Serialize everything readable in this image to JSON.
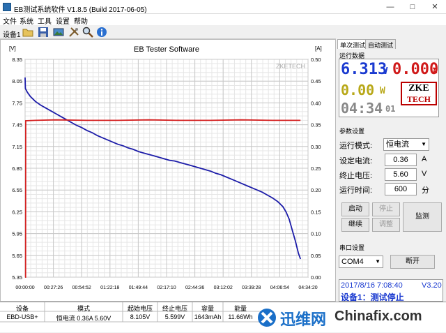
{
  "window": {
    "title": "EB测试系统软件 V1.8.5 (Build 2017-06-05)"
  },
  "menu": [
    "文件",
    "系统",
    "工具",
    "设置",
    "帮助"
  ],
  "toolbar": {
    "device": "设备1"
  },
  "chart_data": {
    "type": "line",
    "title": "EB Tester Software",
    "watermark": "ZKETECH",
    "y_left_unit": "[V]",
    "y_right_unit": "[A]",
    "y_left_ticks": [
      "8.35",
      "8.05",
      "7.75",
      "7.45",
      "7.15",
      "6.85",
      "6.55",
      "6.25",
      "5.95",
      "5.65",
      "5.35"
    ],
    "y_right_ticks": [
      "0.50",
      "0.45",
      "0.40",
      "0.35",
      "0.30",
      "0.25",
      "0.20",
      "0.15",
      "0.10",
      "0.05",
      "0.00"
    ],
    "x_ticks": [
      "00:00:00",
      "00:27:26",
      "00:54:52",
      "01:22:18",
      "01:49:44",
      "02:17:10",
      "02:44:36",
      "03:12:02",
      "03:39:28",
      "04:06:54",
      "04:34:20"
    ],
    "ylim_left": [
      5.35,
      8.35
    ],
    "ylim_right": [
      0,
      0.5
    ],
    "series": [
      {
        "color": "#1c1ca8",
        "axis": "left",
        "points": [
          [
            0,
            8.1
          ],
          [
            0.3,
            7.95
          ],
          [
            2,
            7.9
          ],
          [
            5,
            7.84
          ],
          [
            10,
            7.77
          ],
          [
            15,
            7.72
          ],
          [
            20,
            7.68
          ],
          [
            25,
            7.64
          ],
          [
            30,
            7.6
          ],
          [
            35,
            7.56
          ],
          [
            40,
            7.52
          ],
          [
            45,
            7.48
          ],
          [
            50,
            7.44
          ],
          [
            55,
            7.41
          ],
          [
            60,
            7.37
          ],
          [
            65,
            7.34
          ],
          [
            70,
            7.3
          ],
          [
            75,
            7.27
          ],
          [
            80,
            7.24
          ],
          [
            85,
            7.21
          ],
          [
            90,
            7.18
          ],
          [
            95,
            7.16
          ],
          [
            100,
            7.13
          ],
          [
            105,
            7.11
          ],
          [
            110,
            7.08
          ],
          [
            115,
            7.06
          ],
          [
            120,
            7.04
          ],
          [
            125,
            7.02
          ],
          [
            130,
            7.0
          ],
          [
            135,
            6.98
          ],
          [
            140,
            6.96
          ],
          [
            145,
            6.95
          ],
          [
            150,
            6.93
          ],
          [
            155,
            6.91
          ],
          [
            160,
            6.89
          ],
          [
            165,
            6.87
          ],
          [
            170,
            6.85
          ],
          [
            175,
            6.83
          ],
          [
            180,
            6.81
          ],
          [
            185,
            6.78
          ],
          [
            190,
            6.76
          ],
          [
            195,
            6.73
          ],
          [
            200,
            6.7
          ],
          [
            205,
            6.67
          ],
          [
            210,
            6.64
          ],
          [
            215,
            6.61
          ],
          [
            220,
            6.58
          ],
          [
            225,
            6.55
          ],
          [
            230,
            6.52
          ],
          [
            235,
            6.48
          ],
          [
            240,
            6.44
          ],
          [
            245,
            6.39
          ],
          [
            250,
            6.32
          ],
          [
            253,
            6.25
          ],
          [
            256,
            6.15
          ],
          [
            259,
            6.0
          ],
          [
            262,
            5.85
          ],
          [
            265,
            5.68
          ],
          [
            267,
            5.6
          ]
        ]
      },
      {
        "color": "#d42020",
        "axis": "right",
        "points": [
          [
            0,
            0.0
          ],
          [
            0.5,
            0.0
          ],
          [
            0.6,
            0.359
          ],
          [
            10,
            0.36
          ],
          [
            30,
            0.361
          ],
          [
            60,
            0.36
          ],
          [
            90,
            0.36
          ],
          [
            120,
            0.361
          ],
          [
            150,
            0.36
          ],
          [
            180,
            0.36
          ],
          [
            210,
            0.361
          ],
          [
            240,
            0.36
          ],
          [
            267,
            0.36
          ]
        ]
      }
    ]
  },
  "panel": {
    "tab_single": "单次测试",
    "tab_auto": "自动测试",
    "run_data_label": "运行数据",
    "voltage": "6.313",
    "voltage_unit": "V",
    "current": "0.000",
    "current_unit": "A",
    "power": "0.00",
    "power_unit": "W",
    "time": "04:34",
    "time_sec": "01",
    "logo_top": "ZKE",
    "logo_bottom": "TECH",
    "params_label": "参数设置",
    "mode_label": "运行模式:",
    "mode_value": "恒电流",
    "set_current_label": "设定电流:",
    "set_current_value": "0.36",
    "set_current_unit": "A",
    "stop_voltage_label": "终止电压:",
    "stop_voltage_value": "5.60",
    "stop_voltage_unit": "V",
    "run_time_label": "运行时间:",
    "run_time_value": "600",
    "run_time_unit": "分",
    "btn_start": "启动",
    "btn_stop": "停止",
    "btn_monitor": "监测",
    "btn_continue": "继续",
    "btn_adjust": "调整",
    "serial_label": "串口设置",
    "port_value": "COM4",
    "btn_open": "断开",
    "status_datetime": "2017/8/16 7:08:40",
    "status_version": "V3.20",
    "status_text": "设备1：测试停止"
  },
  "table": {
    "headers": [
      "设备",
      "模式",
      "起始电压",
      "终止电压",
      "容量",
      "能量"
    ],
    "row": [
      "EBD-USB+",
      "恒电流 0.36A 5.60V",
      "8.105V",
      "5.599V",
      "1643mAh",
      "11.66Wh"
    ]
  },
  "watermark": {
    "text1": "迅维网",
    "text2": "Chinafix.com"
  }
}
